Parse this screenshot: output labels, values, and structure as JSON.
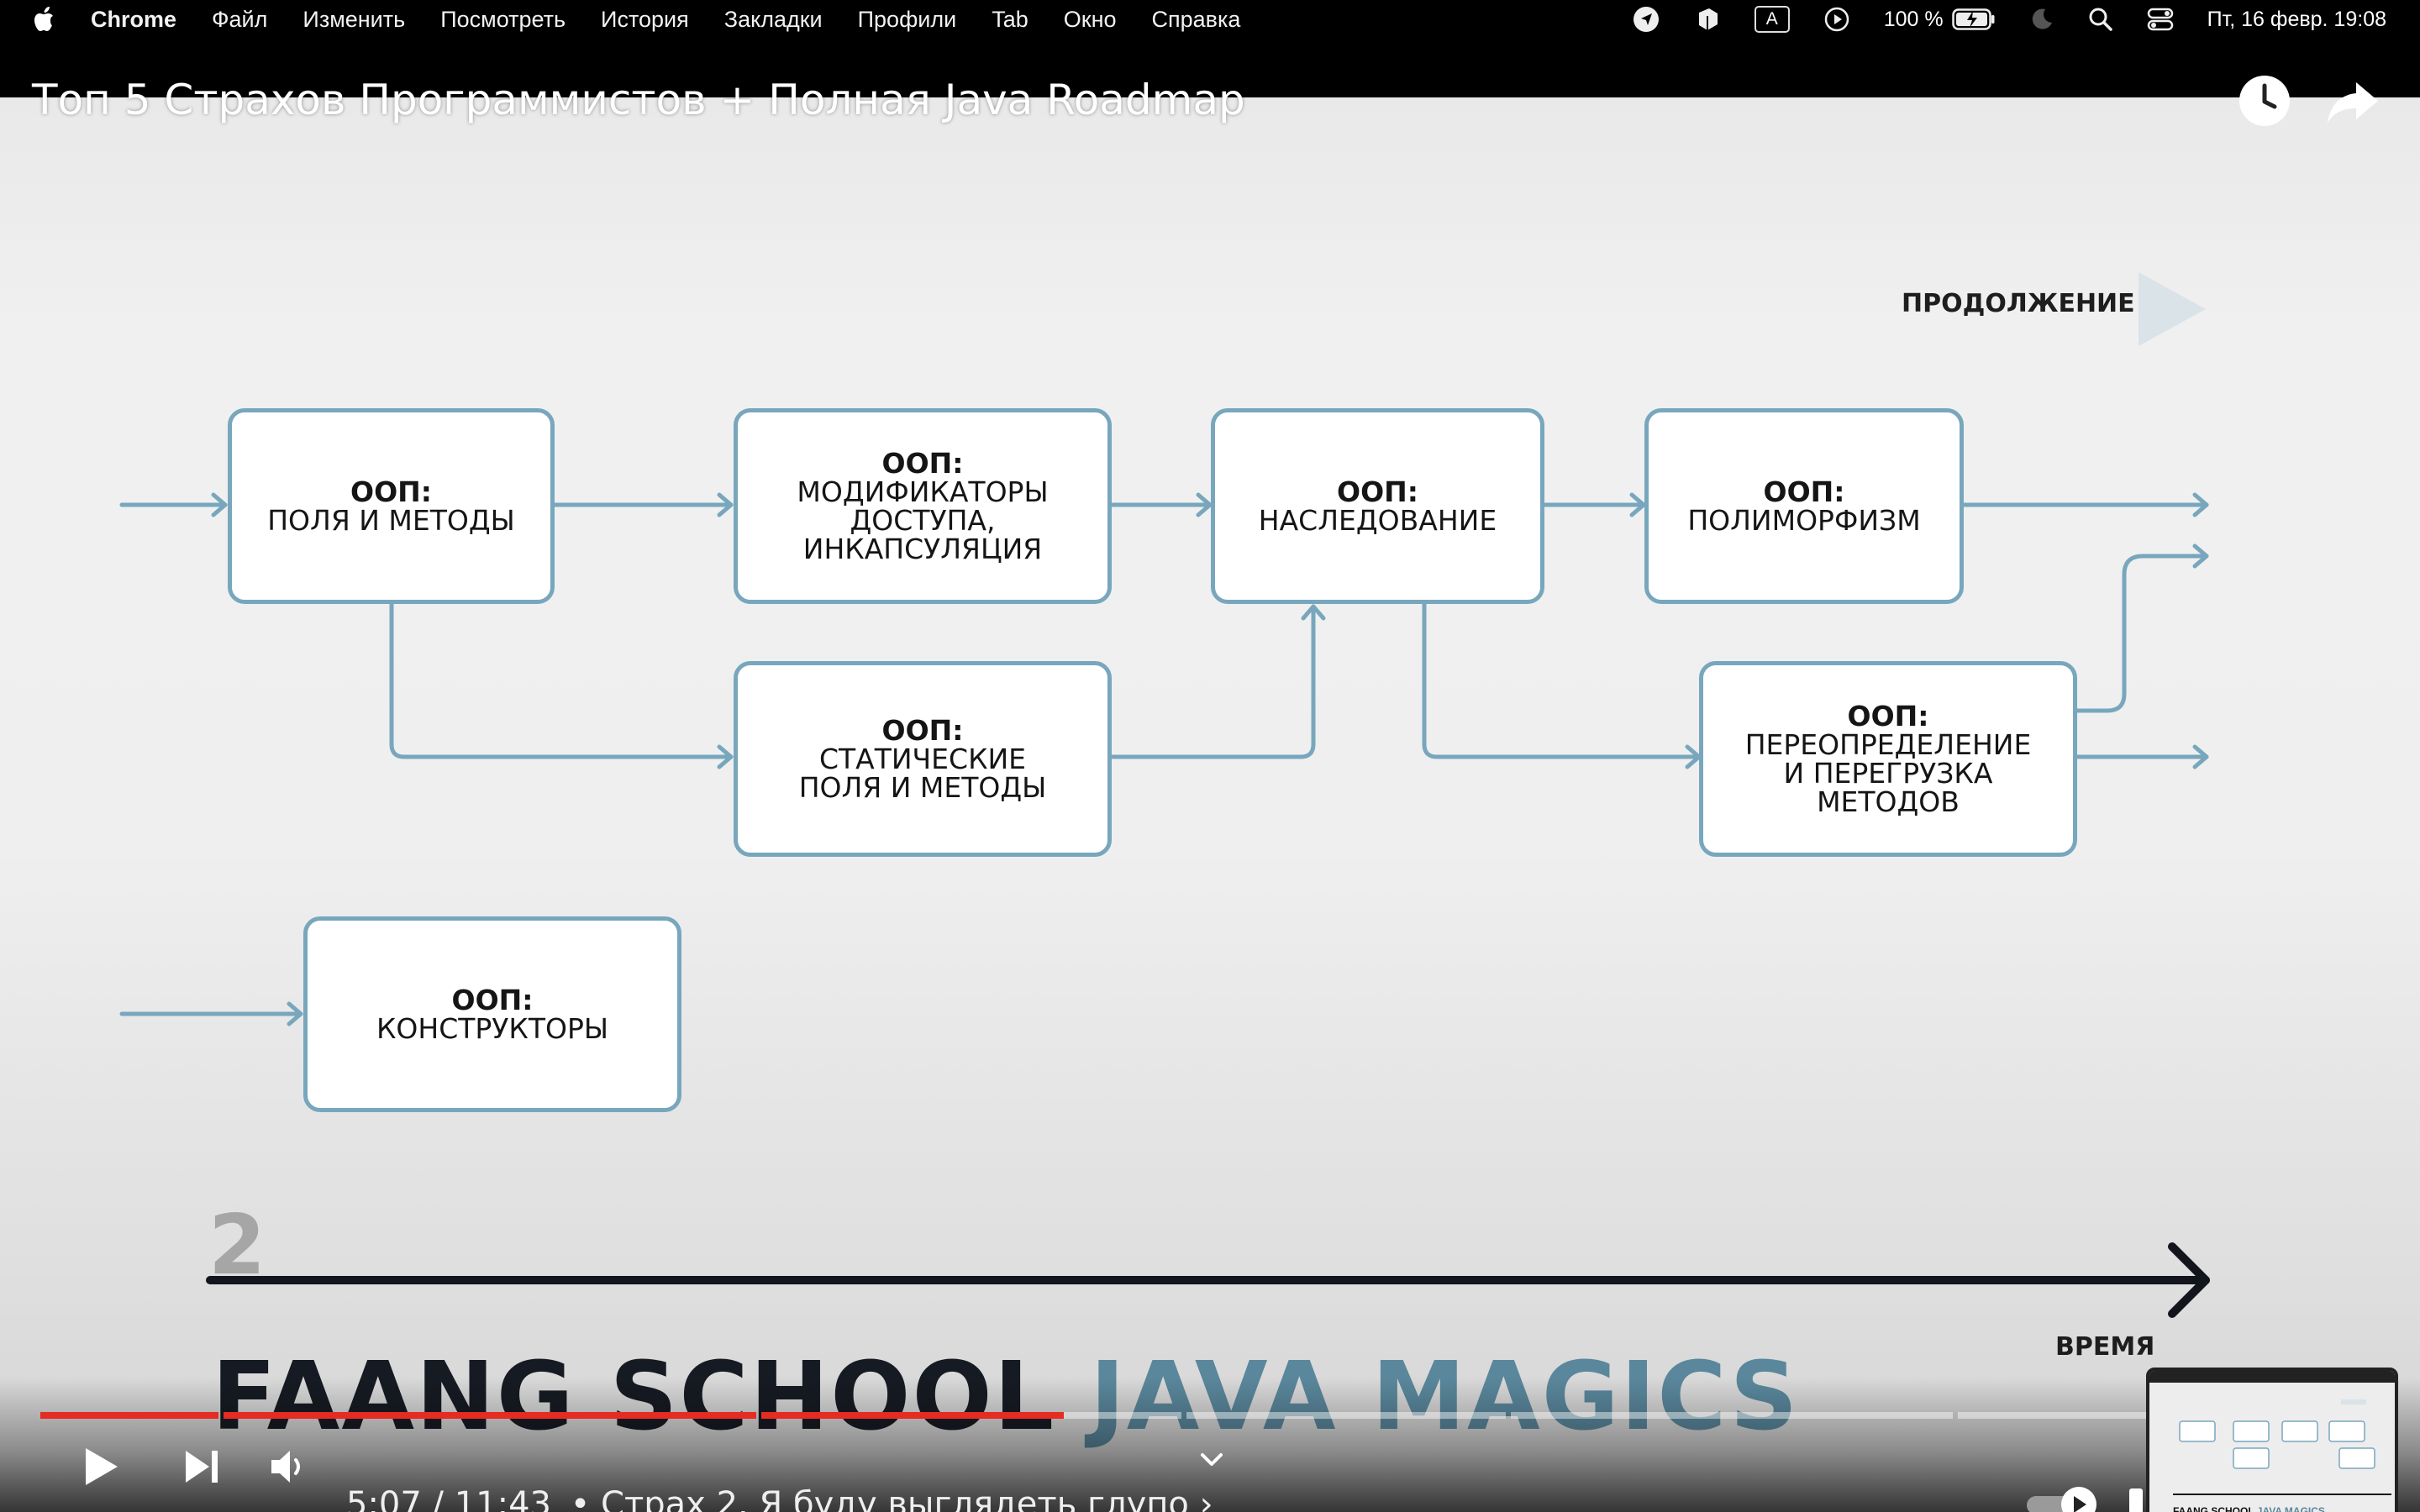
{
  "menubar": {
    "app_name": "Chrome",
    "items": [
      "Файл",
      "Изменить",
      "Посмотреть",
      "История",
      "Закладки",
      "Профили",
      "Tab",
      "Окно",
      "Справка"
    ],
    "battery": "100 %",
    "input_source": "A",
    "datetime": "Пт, 16 февр.  19:08"
  },
  "video": {
    "title": "Топ 5 Страхов Программистов + Полная Java Roadmap",
    "continuation_label": "ПРОДОЛЖЕНИЕ",
    "section_number": "2",
    "timeline_label": "ВРЕМЯ",
    "brand_part1": "FAANG SCHOOL",
    "brand_part2": "JAVA MAGICS",
    "nodes": {
      "fields": {
        "title": "ООП:",
        "lines": [
          "ПОЛЯ И МЕТОДЫ"
        ]
      },
      "modifiers": {
        "title": "ООП:",
        "lines": [
          "МОДИФИКАТОРЫ",
          "ДОСТУПА,",
          "ИНКАПСУЛЯЦИЯ"
        ]
      },
      "inheritance": {
        "title": "ООП:",
        "lines": [
          "НАСЛЕДОВАНИЕ"
        ]
      },
      "polymorphism": {
        "title": "ООП:",
        "lines": [
          "ПОЛИМОРФИЗМ"
        ]
      },
      "static": {
        "title": "ООП:",
        "lines": [
          "СТАТИЧЕСКИЕ",
          "ПОЛЯ И МЕТОДЫ"
        ]
      },
      "overriding": {
        "title": "ООП:",
        "lines": [
          "ПЕРЕОПРЕДЕЛЕНИЕ",
          "И ПЕРЕГРУЗКА",
          "МЕТОДОВ"
        ]
      },
      "constructors": {
        "title": "ООП:",
        "lines": [
          "КОНСТРУКТОРЫ"
        ]
      }
    },
    "accent_color": "#78a7bd",
    "brand_accent_color": "#5a879c"
  },
  "player": {
    "current_time": "5:07",
    "duration": "11:43",
    "time_display": "5:07 / 11:43",
    "chapter": "• Страх 2. Я буду выглядеть глупо ›",
    "progress_color": "#e52b22",
    "progress_fraction": 0.437,
    "thumbnail_brand_part1": "FAANG SCHOOL",
    "thumbnail_brand_part2": "JAVA MAGICS",
    "icons": [
      "play-icon",
      "next-icon",
      "volume-icon",
      "chevron-down-icon",
      "autoplay-toggle-icon",
      "watch-later-icon",
      "share-icon"
    ]
  }
}
